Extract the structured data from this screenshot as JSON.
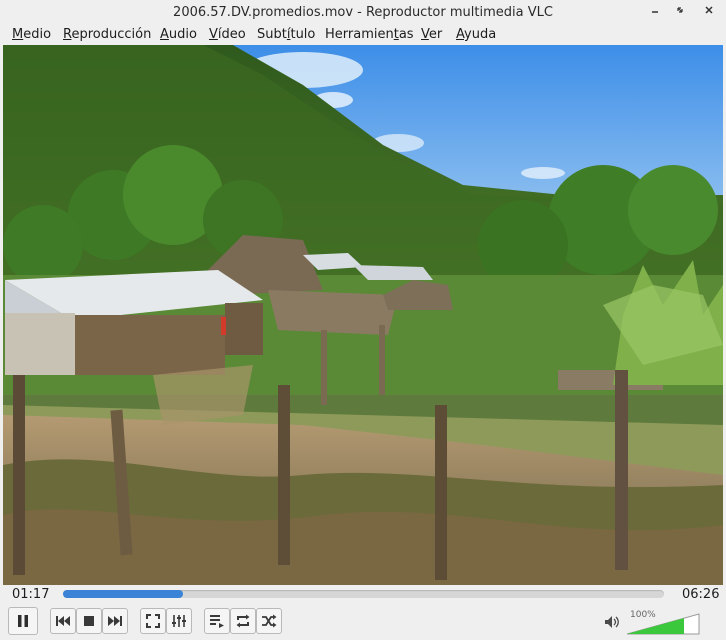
{
  "window": {
    "title": "2006.57.DV.promedios.mov - Reproductor multimedia VLC",
    "controls": [
      "minimize-icon",
      "maximize-icon",
      "close-icon"
    ]
  },
  "menu": {
    "items": [
      {
        "pre": "",
        "ul": "M",
        "post": "edio"
      },
      {
        "pre": "",
        "ul": "R",
        "post": "eproducción"
      },
      {
        "pre": "",
        "ul": "A",
        "post": "udio"
      },
      {
        "pre": "",
        "ul": "V",
        "post": "ídeo"
      },
      {
        "pre": "Subt",
        "ul": "í",
        "post": "tulo"
      },
      {
        "pre": "Herramien",
        "ul": "t",
        "post": "as"
      },
      {
        "pre": "",
        "ul": "V",
        "post": "er"
      },
      {
        "pre": "",
        "ul": "A",
        "post": "yuda"
      }
    ]
  },
  "playback": {
    "elapsed": "01:17",
    "total": "06:26",
    "progress_fraction": 0.2
  },
  "volume": {
    "label": "100%",
    "level_fraction": 1.0
  },
  "icons": {
    "pause": "pause-icon",
    "previous": "previous-icon",
    "stop": "stop-icon",
    "next": "next-icon",
    "fullscreen": "fullscreen-icon",
    "extended": "equalizer-icon",
    "playlist": "playlist-icon",
    "loop": "loop-icon",
    "shuffle": "shuffle-icon",
    "speaker": "speaker-icon"
  },
  "colors": {
    "seek_fill": "#3a83d6",
    "volume_fill": "#3cc83c"
  }
}
